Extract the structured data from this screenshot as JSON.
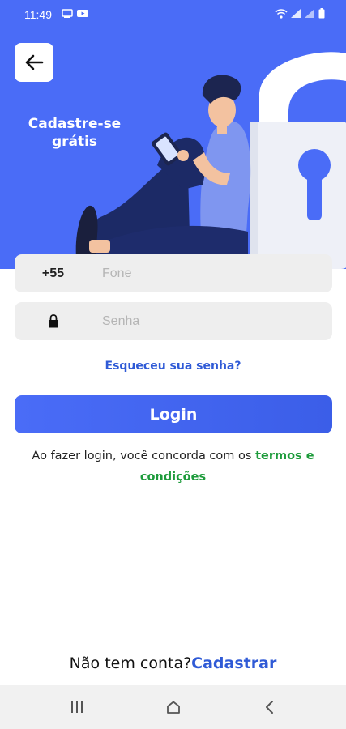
{
  "status_bar": {
    "time": "11:49",
    "left_icons": [
      "screen-cast-icon",
      "youtube-icon"
    ],
    "right_icons": [
      "wifi-icon",
      "signal-icon",
      "signal-icon",
      "battery-icon"
    ]
  },
  "header": {
    "back_icon": "arrow-left-icon",
    "title": "Cadastre-se grátis"
  },
  "form": {
    "phone_prefix": "+55",
    "phone_placeholder": "Fone",
    "password_icon": "lock-icon",
    "password_placeholder": "Senha",
    "forgot_password": "Esqueceu sua senha?",
    "login_label": "Login"
  },
  "terms": {
    "text": "Ao fazer login, você concorda com os ",
    "link": "termos e condições"
  },
  "signup": {
    "text": "Não tem conta?",
    "link": "Cadastrar"
  },
  "nav_bar": {
    "icons": [
      "recent-apps-icon",
      "home-icon",
      "back-icon"
    ]
  },
  "colors": {
    "hero_bg": "#4a6cf7",
    "primary": "#2f5ad6",
    "terms_link": "#1d9b3b",
    "field_bg": "#eeeeee"
  }
}
